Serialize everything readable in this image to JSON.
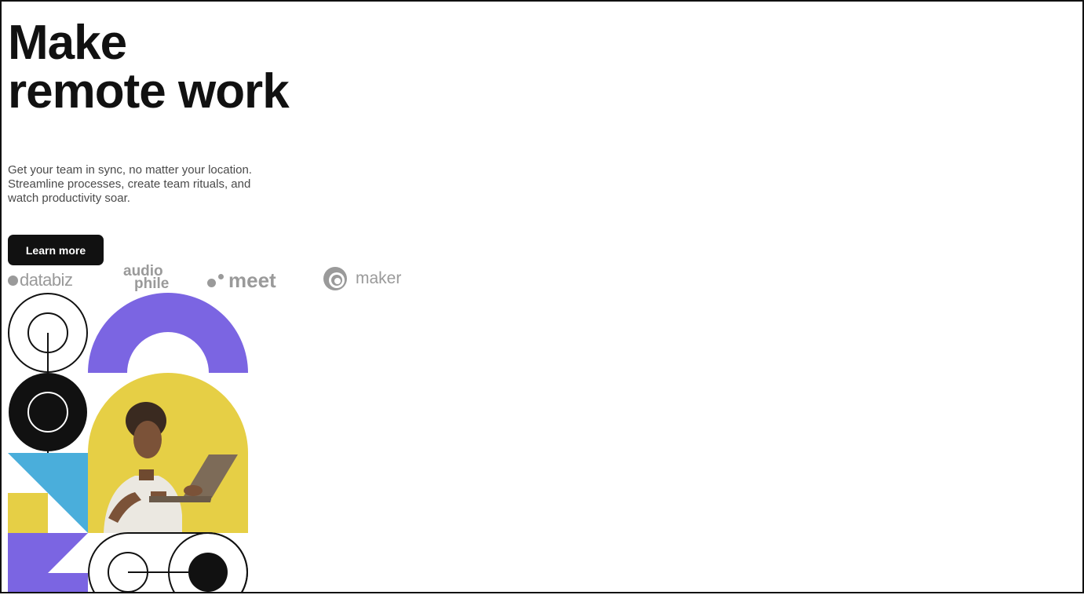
{
  "hero": {
    "headline_line1": "Make",
    "headline_line2": "remote work",
    "description_line1": "Get your team in sync, no matter your location.",
    "description_line2": "Streamline processes, create team rituals, and",
    "description_line3": "watch productivity soar.",
    "cta_label": "Learn more"
  },
  "clients": {
    "databiz": "databiz",
    "audiophile_line1": "audio",
    "audiophile_line2": "phile",
    "meet": "meet",
    "maker": "maker"
  },
  "colors": {
    "text_dark": "#111111",
    "text_muted": "#4a4a4a",
    "logo_gray": "#9a9a9a",
    "purple": "#7b65e2",
    "yellow": "#e6cf45",
    "blue": "#4aaedb"
  },
  "icons": {
    "databiz": "dot-icon",
    "meet": "two-dots-icon",
    "maker": "swirl-circle-icon"
  }
}
